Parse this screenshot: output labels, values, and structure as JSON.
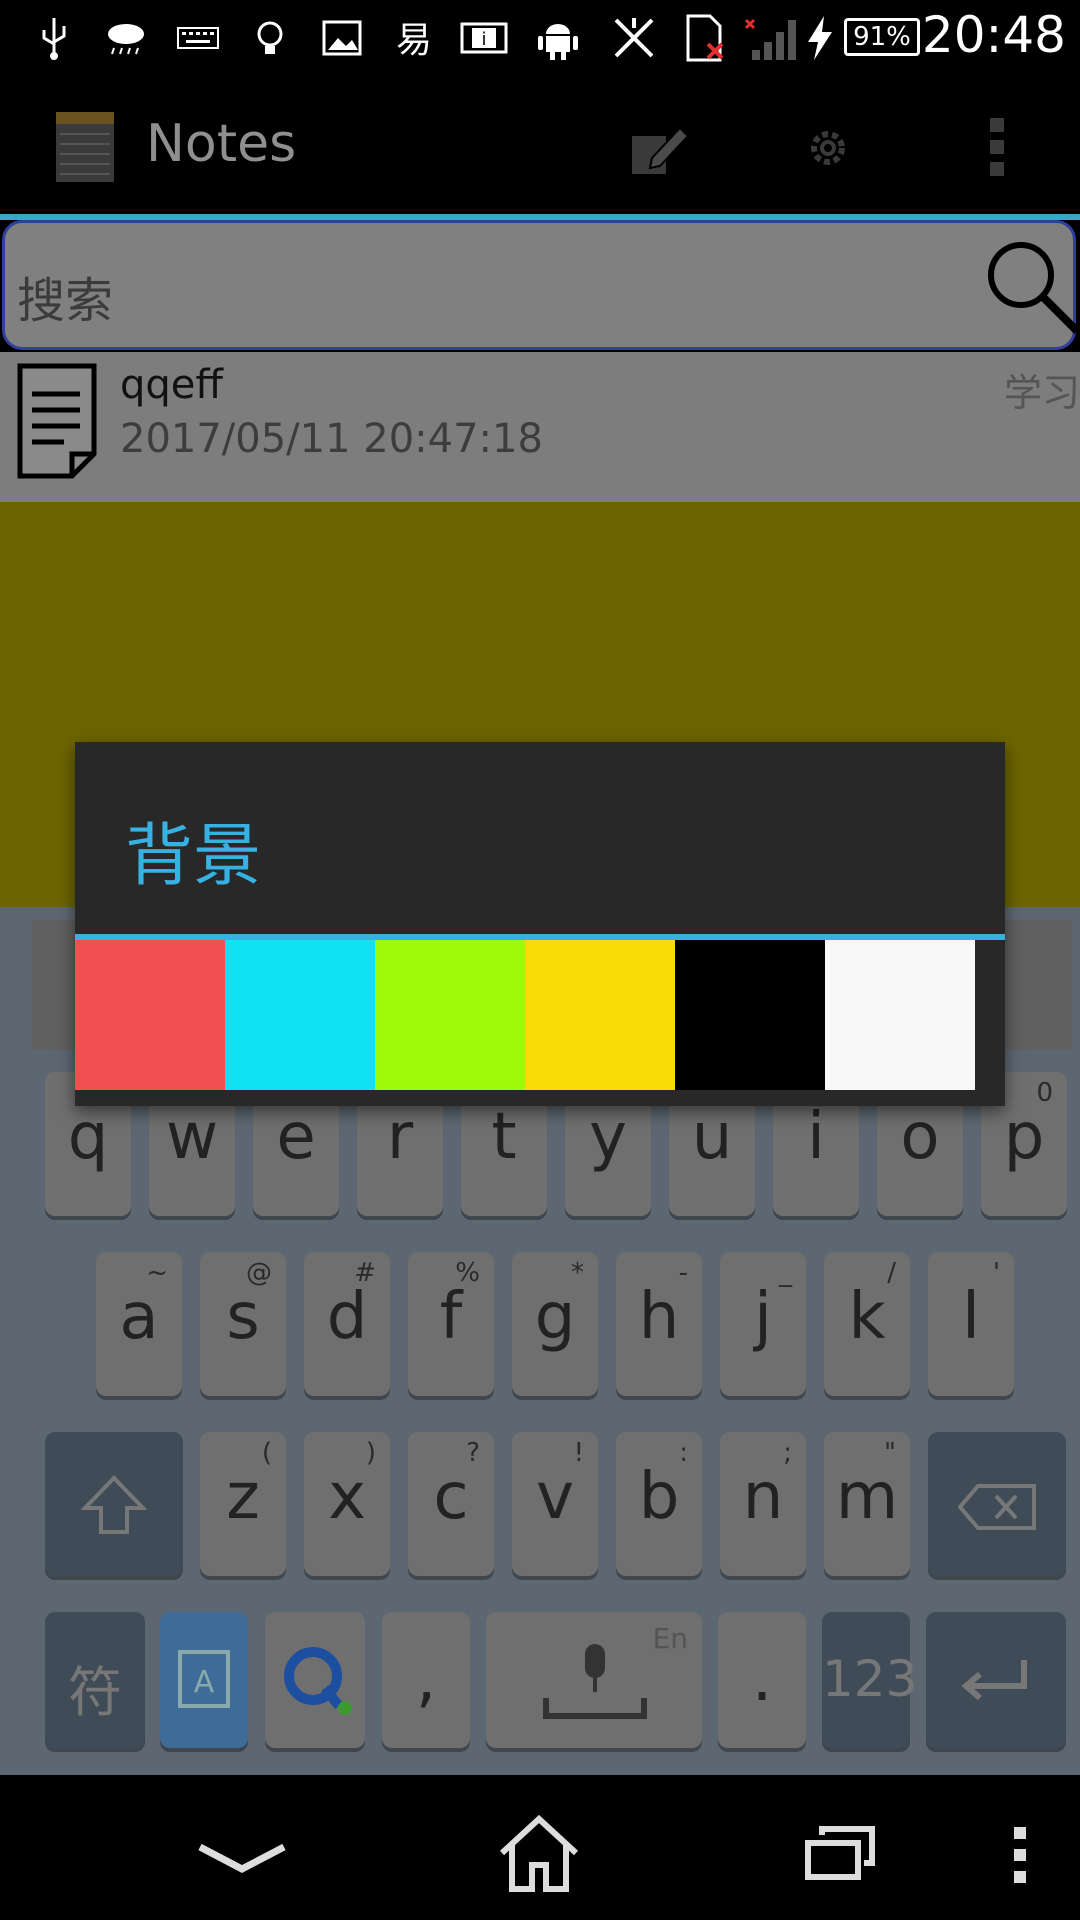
{
  "status_bar": {
    "battery_percent": "91%",
    "time": "20:48",
    "icons": [
      "usb-icon",
      "cloud-rain-icon",
      "keyboard-icon",
      "bulb-icon",
      "image-icon",
      "app-icon",
      "info-icon",
      "android-icon",
      "no-data-icon",
      "sim-error-icon",
      "signal-icon",
      "charging-icon",
      "battery-icon"
    ]
  },
  "action_bar": {
    "title": "Notes",
    "icons": [
      "notes-app-icon",
      "edit-icon",
      "settings-icon",
      "overflow-menu-icon"
    ]
  },
  "search": {
    "placeholder": "搜索"
  },
  "notes": [
    {
      "title": "qqeff",
      "date": "2017/05/11 20:47:18",
      "category": "学习"
    }
  ],
  "dialog": {
    "title": "背景",
    "colors": [
      "#f05050",
      "#0fe2f0",
      "#9ffa0a",
      "#f8dc08",
      "#000000",
      "#f8f8f8"
    ]
  },
  "keyboard": {
    "row1": [
      {
        "key": "q",
        "sub": ""
      },
      {
        "key": "w",
        "sub": ""
      },
      {
        "key": "e",
        "sub": ""
      },
      {
        "key": "r",
        "sub": ""
      },
      {
        "key": "t",
        "sub": ""
      },
      {
        "key": "y",
        "sub": ""
      },
      {
        "key": "u",
        "sub": ""
      },
      {
        "key": "i",
        "sub": ""
      },
      {
        "key": "o",
        "sub": ""
      },
      {
        "key": "p",
        "sub": "0"
      }
    ],
    "row2": [
      {
        "key": "a",
        "sub": "~"
      },
      {
        "key": "s",
        "sub": "@"
      },
      {
        "key": "d",
        "sub": "#"
      },
      {
        "key": "f",
        "sub": "%"
      },
      {
        "key": "g",
        "sub": "*"
      },
      {
        "key": "h",
        "sub": "-"
      },
      {
        "key": "j",
        "sub": "_"
      },
      {
        "key": "k",
        "sub": "/"
      },
      {
        "key": "l",
        "sub": "'"
      }
    ],
    "row3": [
      {
        "key": "z",
        "sub": "("
      },
      {
        "key": "x",
        "sub": ")"
      },
      {
        "key": "c",
        "sub": "?"
      },
      {
        "key": "v",
        "sub": "!"
      },
      {
        "key": "b",
        "sub": ":"
      },
      {
        "key": "n",
        "sub": ";"
      },
      {
        "key": "m",
        "sub": "\""
      }
    ],
    "symbol_key": "符",
    "comma_key": ",",
    "space_hint": "En",
    "period_key": ".",
    "numbers_key": "123"
  },
  "nav_bar": {
    "icons": [
      "back-icon",
      "home-icon",
      "recents-icon",
      "menu-icon"
    ]
  }
}
